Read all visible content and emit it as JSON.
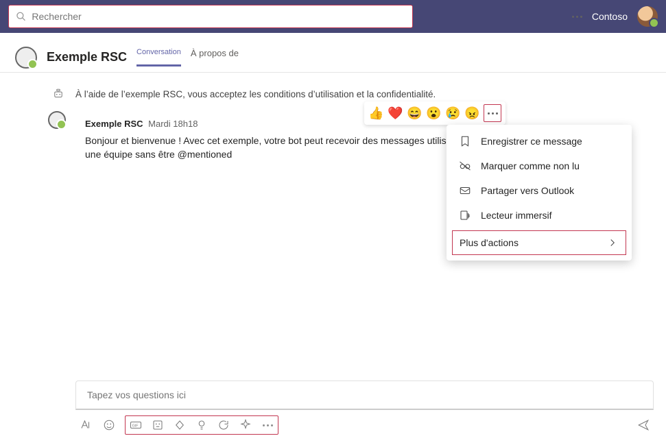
{
  "top": {
    "search_placeholder": "Rechercher",
    "org": "Contoso"
  },
  "header": {
    "title": "Exemple RSC",
    "tab_chat": "Conversation",
    "tab_about": "À propos de"
  },
  "info_text": "À l’aide de l’exemple RSC, vous acceptez les conditions d’utilisation et la confidentialité.",
  "message": {
    "sender": "Exemple RSC",
    "timestamp": "Mardi 18h18",
    "body": "Bonjour et bienvenue ! Avec cet exemple, votre bot peut recevoir des messages utilisateur dans une équipe sans être @mentioned"
  },
  "reactions": [
    "👍",
    "❤️",
    "😄",
    "😮",
    "😢",
    "😠"
  ],
  "menu": {
    "save": "Enregistrer ce message",
    "unread": "Marquer comme non lu",
    "outlook": "Partager vers Outlook",
    "reader": "Lecteur immersif",
    "more": "Plus d'actions"
  },
  "composer": {
    "placeholder": "Tapez vos questions ici"
  }
}
